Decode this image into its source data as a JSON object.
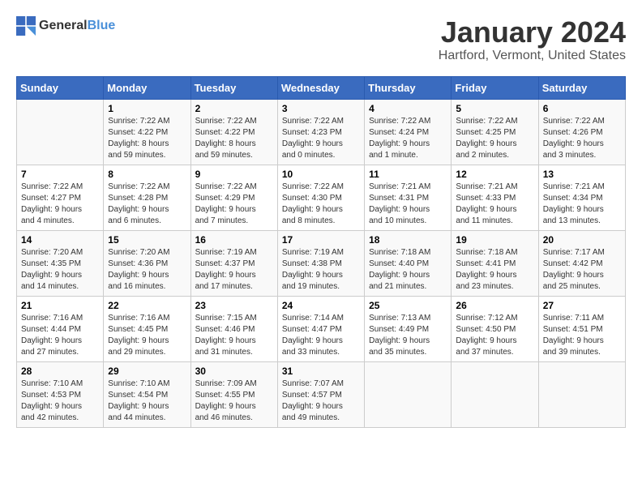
{
  "header": {
    "logo_general": "General",
    "logo_blue": "Blue",
    "title": "January 2024",
    "subtitle": "Hartford, Vermont, United States"
  },
  "calendar": {
    "days_of_week": [
      "Sunday",
      "Monday",
      "Tuesday",
      "Wednesday",
      "Thursday",
      "Friday",
      "Saturday"
    ],
    "weeks": [
      [
        {
          "day": "",
          "info": ""
        },
        {
          "day": "1",
          "info": "Sunrise: 7:22 AM\nSunset: 4:22 PM\nDaylight: 8 hours\nand 59 minutes."
        },
        {
          "day": "2",
          "info": "Sunrise: 7:22 AM\nSunset: 4:22 PM\nDaylight: 8 hours\nand 59 minutes."
        },
        {
          "day": "3",
          "info": "Sunrise: 7:22 AM\nSunset: 4:23 PM\nDaylight: 9 hours\nand 0 minutes."
        },
        {
          "day": "4",
          "info": "Sunrise: 7:22 AM\nSunset: 4:24 PM\nDaylight: 9 hours\nand 1 minute."
        },
        {
          "day": "5",
          "info": "Sunrise: 7:22 AM\nSunset: 4:25 PM\nDaylight: 9 hours\nand 2 minutes."
        },
        {
          "day": "6",
          "info": "Sunrise: 7:22 AM\nSunset: 4:26 PM\nDaylight: 9 hours\nand 3 minutes."
        }
      ],
      [
        {
          "day": "7",
          "info": "Sunrise: 7:22 AM\nSunset: 4:27 PM\nDaylight: 9 hours\nand 4 minutes."
        },
        {
          "day": "8",
          "info": "Sunrise: 7:22 AM\nSunset: 4:28 PM\nDaylight: 9 hours\nand 6 minutes."
        },
        {
          "day": "9",
          "info": "Sunrise: 7:22 AM\nSunset: 4:29 PM\nDaylight: 9 hours\nand 7 minutes."
        },
        {
          "day": "10",
          "info": "Sunrise: 7:22 AM\nSunset: 4:30 PM\nDaylight: 9 hours\nand 8 minutes."
        },
        {
          "day": "11",
          "info": "Sunrise: 7:21 AM\nSunset: 4:31 PM\nDaylight: 9 hours\nand 10 minutes."
        },
        {
          "day": "12",
          "info": "Sunrise: 7:21 AM\nSunset: 4:33 PM\nDaylight: 9 hours\nand 11 minutes."
        },
        {
          "day": "13",
          "info": "Sunrise: 7:21 AM\nSunset: 4:34 PM\nDaylight: 9 hours\nand 13 minutes."
        }
      ],
      [
        {
          "day": "14",
          "info": "Sunrise: 7:20 AM\nSunset: 4:35 PM\nDaylight: 9 hours\nand 14 minutes."
        },
        {
          "day": "15",
          "info": "Sunrise: 7:20 AM\nSunset: 4:36 PM\nDaylight: 9 hours\nand 16 minutes."
        },
        {
          "day": "16",
          "info": "Sunrise: 7:19 AM\nSunset: 4:37 PM\nDaylight: 9 hours\nand 17 minutes."
        },
        {
          "day": "17",
          "info": "Sunrise: 7:19 AM\nSunset: 4:38 PM\nDaylight: 9 hours\nand 19 minutes."
        },
        {
          "day": "18",
          "info": "Sunrise: 7:18 AM\nSunset: 4:40 PM\nDaylight: 9 hours\nand 21 minutes."
        },
        {
          "day": "19",
          "info": "Sunrise: 7:18 AM\nSunset: 4:41 PM\nDaylight: 9 hours\nand 23 minutes."
        },
        {
          "day": "20",
          "info": "Sunrise: 7:17 AM\nSunset: 4:42 PM\nDaylight: 9 hours\nand 25 minutes."
        }
      ],
      [
        {
          "day": "21",
          "info": "Sunrise: 7:16 AM\nSunset: 4:44 PM\nDaylight: 9 hours\nand 27 minutes."
        },
        {
          "day": "22",
          "info": "Sunrise: 7:16 AM\nSunset: 4:45 PM\nDaylight: 9 hours\nand 29 minutes."
        },
        {
          "day": "23",
          "info": "Sunrise: 7:15 AM\nSunset: 4:46 PM\nDaylight: 9 hours\nand 31 minutes."
        },
        {
          "day": "24",
          "info": "Sunrise: 7:14 AM\nSunset: 4:47 PM\nDaylight: 9 hours\nand 33 minutes."
        },
        {
          "day": "25",
          "info": "Sunrise: 7:13 AM\nSunset: 4:49 PM\nDaylight: 9 hours\nand 35 minutes."
        },
        {
          "day": "26",
          "info": "Sunrise: 7:12 AM\nSunset: 4:50 PM\nDaylight: 9 hours\nand 37 minutes."
        },
        {
          "day": "27",
          "info": "Sunrise: 7:11 AM\nSunset: 4:51 PM\nDaylight: 9 hours\nand 39 minutes."
        }
      ],
      [
        {
          "day": "28",
          "info": "Sunrise: 7:10 AM\nSunset: 4:53 PM\nDaylight: 9 hours\nand 42 minutes."
        },
        {
          "day": "29",
          "info": "Sunrise: 7:10 AM\nSunset: 4:54 PM\nDaylight: 9 hours\nand 44 minutes."
        },
        {
          "day": "30",
          "info": "Sunrise: 7:09 AM\nSunset: 4:55 PM\nDaylight: 9 hours\nand 46 minutes."
        },
        {
          "day": "31",
          "info": "Sunrise: 7:07 AM\nSunset: 4:57 PM\nDaylight: 9 hours\nand 49 minutes."
        },
        {
          "day": "",
          "info": ""
        },
        {
          "day": "",
          "info": ""
        },
        {
          "day": "",
          "info": ""
        }
      ]
    ]
  }
}
